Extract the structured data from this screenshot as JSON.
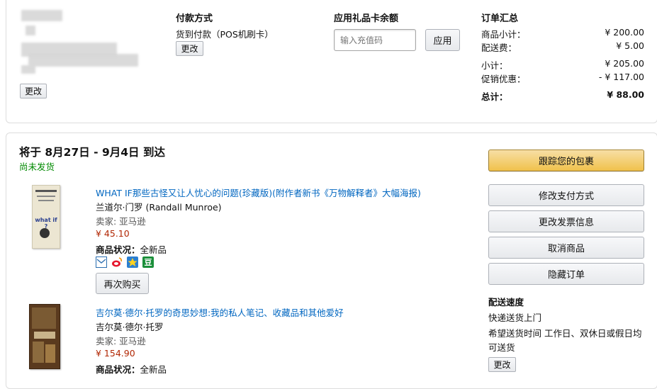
{
  "top": {
    "address_change_label": "更改",
    "payment": {
      "title": "付款方式",
      "method": "货到付款（POS机刷卡）",
      "change_label": "更改"
    },
    "gift": {
      "title": "应用礼品卡余额",
      "placeholder": "输入充值码",
      "apply_label": "应用"
    },
    "summary": {
      "title": "订单汇总",
      "rows": [
        {
          "label": "商品小计：",
          "value": "¥ 200.00"
        },
        {
          "label": "配送费：",
          "value": "¥ 5.00"
        },
        {
          "label": "小计：",
          "value": "¥ 205.00"
        },
        {
          "label": "促销优惠：",
          "value": "- ¥ 117.00"
        },
        {
          "label": "总计：",
          "value": "¥ 88.00"
        }
      ]
    }
  },
  "shipment": {
    "delivery_title": "将于 8月27日 - 9月4日 到达",
    "status": "尚未发货",
    "actions": {
      "track": "跟踪您的包裹",
      "change_payment": "修改支付方式",
      "change_invoice": "更改发票信息",
      "cancel": "取消商品",
      "hide": "隐藏订单"
    },
    "speed": {
      "title": "配送速度",
      "option": "快递送货上门",
      "preference": "希望送货时间 工作日、双休日或假日均可送货",
      "change_label": "更改"
    },
    "items": [
      {
        "title": "WHAT IF那些古怪又让人忧心的问题(珍藏版)(附作者新书《万物解释者》大幅海报)",
        "author": "兰道尔·门罗 (Randall Munroe)",
        "seller": "卖家: 亚马逊",
        "price": "¥ 45.10",
        "condition_label": "商品状况：",
        "condition": "全新品",
        "cover_text": "what if ?",
        "share_icons": [
          "email-icon",
          "weibo-icon",
          "qzone-icon",
          "douban-icon"
        ],
        "douban_glyph": "豆",
        "buy_again": "再次购买"
      },
      {
        "title": "吉尔莫·德尔·托罗的奇思妙想:我的私人笔记、收藏品和其他爱好",
        "author": "吉尔莫·德尔·托罗",
        "seller": "卖家: 亚马逊",
        "price": "¥ 154.90",
        "condition_label": "商品状况：",
        "condition": "全新品"
      }
    ]
  },
  "colors": {
    "link": "#0066c0",
    "price": "#b12704",
    "status": "#008a00",
    "track_button": "#f0c14b"
  }
}
